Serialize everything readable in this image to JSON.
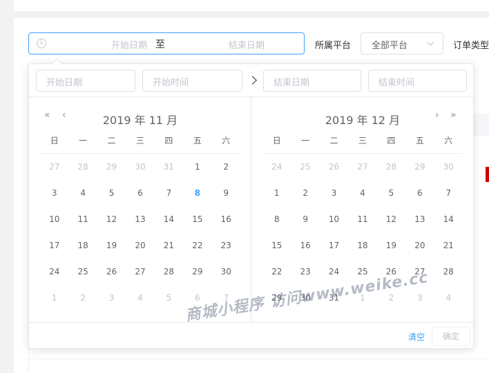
{
  "range_input": {
    "start_placeholder": "开始日期",
    "separator": "至",
    "end_placeholder": "结束日期"
  },
  "filters": {
    "platform_label": "所属平台",
    "platform_value": "全部平台",
    "order_type_label": "订单类型"
  },
  "picker": {
    "start_date_placeholder": "开始日期",
    "start_time_placeholder": "开始时间",
    "end_date_placeholder": "结束日期",
    "end_time_placeholder": "结束时间",
    "weekdays": [
      "日",
      "一",
      "二",
      "三",
      "四",
      "五",
      "六"
    ],
    "left": {
      "title": "2019 年 11 月",
      "days": [
        {
          "d": "27",
          "other": true
        },
        {
          "d": "28",
          "other": true
        },
        {
          "d": "29",
          "other": true
        },
        {
          "d": "30",
          "other": true
        },
        {
          "d": "31",
          "other": true
        },
        {
          "d": "1"
        },
        {
          "d": "2"
        },
        {
          "d": "3"
        },
        {
          "d": "4"
        },
        {
          "d": "5"
        },
        {
          "d": "6"
        },
        {
          "d": "7"
        },
        {
          "d": "8",
          "today": true
        },
        {
          "d": "9"
        },
        {
          "d": "10"
        },
        {
          "d": "11"
        },
        {
          "d": "12"
        },
        {
          "d": "13"
        },
        {
          "d": "14"
        },
        {
          "d": "15"
        },
        {
          "d": "16"
        },
        {
          "d": "17"
        },
        {
          "d": "18"
        },
        {
          "d": "19"
        },
        {
          "d": "20"
        },
        {
          "d": "21"
        },
        {
          "d": "22"
        },
        {
          "d": "23"
        },
        {
          "d": "24"
        },
        {
          "d": "25"
        },
        {
          "d": "26"
        },
        {
          "d": "27"
        },
        {
          "d": "28"
        },
        {
          "d": "29"
        },
        {
          "d": "30"
        },
        {
          "d": "1",
          "other": true
        },
        {
          "d": "2",
          "other": true
        },
        {
          "d": "3",
          "other": true
        },
        {
          "d": "4",
          "other": true
        },
        {
          "d": "5",
          "other": true
        },
        {
          "d": "6",
          "other": true
        },
        {
          "d": "7",
          "other": true
        }
      ]
    },
    "right": {
      "title": "2019 年 12 月",
      "days": [
        {
          "d": "24",
          "other": true
        },
        {
          "d": "25",
          "other": true
        },
        {
          "d": "26",
          "other": true
        },
        {
          "d": "27",
          "other": true
        },
        {
          "d": "28",
          "other": true
        },
        {
          "d": "29",
          "other": true
        },
        {
          "d": "30",
          "other": true
        },
        {
          "d": "1"
        },
        {
          "d": "2"
        },
        {
          "d": "3"
        },
        {
          "d": "4"
        },
        {
          "d": "5"
        },
        {
          "d": "6"
        },
        {
          "d": "7"
        },
        {
          "d": "8"
        },
        {
          "d": "9"
        },
        {
          "d": "10"
        },
        {
          "d": "11"
        },
        {
          "d": "12"
        },
        {
          "d": "13"
        },
        {
          "d": "14"
        },
        {
          "d": "15"
        },
        {
          "d": "16"
        },
        {
          "d": "17"
        },
        {
          "d": "18"
        },
        {
          "d": "19"
        },
        {
          "d": "20"
        },
        {
          "d": "21"
        },
        {
          "d": "22"
        },
        {
          "d": "23"
        },
        {
          "d": "24"
        },
        {
          "d": "25"
        },
        {
          "d": "26"
        },
        {
          "d": "27"
        },
        {
          "d": "28"
        },
        {
          "d": "29"
        },
        {
          "d": "30"
        },
        {
          "d": "31"
        },
        {
          "d": "1",
          "other": true
        },
        {
          "d": "2",
          "other": true
        },
        {
          "d": "3",
          "other": true
        },
        {
          "d": "4",
          "other": true
        }
      ]
    },
    "clear_label": "清空",
    "confirm_label": "确定"
  },
  "icons": {
    "prev_year": "«",
    "prev_month": "‹",
    "next_month": "›",
    "next_year": "»"
  },
  "watermark": "商城小程序 访问www.weike.cc",
  "colors": {
    "accent": "#409eff",
    "muted": "#c0c4cc",
    "text": "#606266"
  }
}
